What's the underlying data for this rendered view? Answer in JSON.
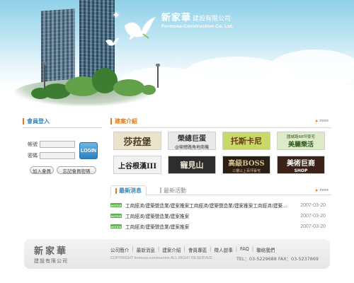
{
  "header": {
    "brand_cn": "新家華",
    "brand_cn_suffix": "建設有限公司",
    "brand_en": "Formosa-Construction Co. Ltd."
  },
  "login": {
    "title": "會員登入",
    "account_label": "帳號",
    "account_value": "",
    "password_label": "密碼",
    "password_value": "",
    "login_button": "LOGIN",
    "join_button": "加入會員",
    "forgot_button": "忘記會員密碼"
  },
  "projects": {
    "title": "建案介紹",
    "more_label": "more",
    "items": [
      {
        "title": "莎菈堡",
        "subtitle": "",
        "bg": "#ece3cc",
        "fg": "#4a3a1e"
      },
      {
        "title": "榮總巨蛋",
        "subtitle": "@榮總路角地商機",
        "bg": "#e9e9e9",
        "fg": "#333333"
      },
      {
        "title": "托斯卡尼",
        "subtitle": "",
        "bg": "#c8d96a",
        "fg": "#6b3b14"
      },
      {
        "title": "美麗樂活",
        "subtitle": "國城路68坪豪宅",
        "bg": "#dfeac9",
        "fg": "#2f5a22"
      },
      {
        "title": "上谷根漢III",
        "subtitle": "",
        "bg": "#f2f2f2",
        "fg": "#1a1a1a"
      },
      {
        "title": "寵見山",
        "subtitle": "",
        "bg": "#2d2d2d",
        "fg": "#e8e2d0"
      },
      {
        "title": "高級BOSS",
        "subtitle": "三樓以上百坪豪宅",
        "bg": "#2b1e14",
        "fg": "#d6c28a"
      },
      {
        "title": "美術巨商",
        "subtitle": "SHOP",
        "bg": "#3a2218",
        "fg": "#ffffff"
      }
    ]
  },
  "news": {
    "tab_active": "最新消息",
    "tab_inactive": "最新活動",
    "more_label": "more",
    "items": [
      {
        "badge": "NOTICE",
        "title": "工商經濟/建築營造業/建案推案工商經濟/建築營造業/建案推案工商經濟/建築...",
        "date": "2007-03-20"
      },
      {
        "badge": "NOTICE",
        "title": "工商經濟/建築營造業/建案推案",
        "date": "2007-03-20"
      },
      {
        "badge": "NOTICE",
        "title": "工商經濟/建築營造業/建案推案",
        "date": "2007-03-20"
      }
    ]
  },
  "footer": {
    "brand_cn": "新家華",
    "brand_sub": "建設有限公司",
    "nav": [
      "公司簡介",
      "最新消息",
      "建案介紹",
      "會員專區",
      "徵人啟事",
      "FAQ",
      "聯絡我們"
    ],
    "copyright": "COPYRIGHT formosa-construction  ALL RIGHT RESERVED",
    "contact": "TEL：03-5229688  FAX：03-5237869"
  },
  "colors": {
    "accent_orange": "#e07a1a",
    "accent_blue": "#3a86b8",
    "notice_green": "#5cb04a"
  }
}
